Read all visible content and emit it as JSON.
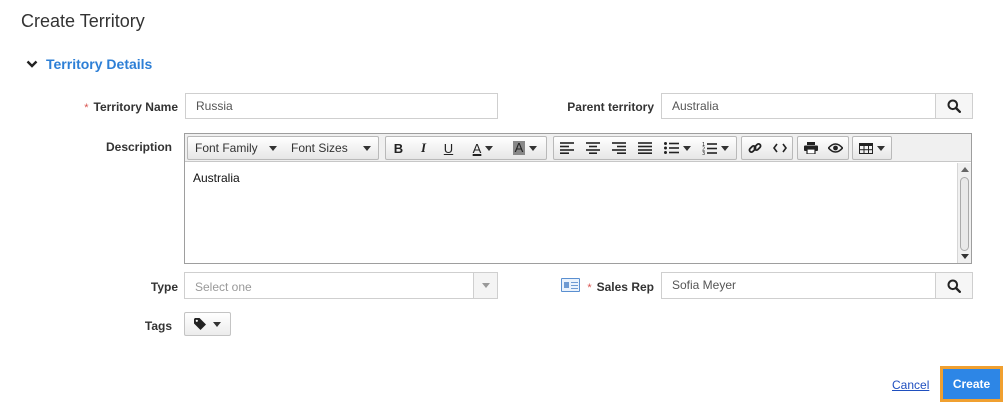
{
  "page": {
    "title": "Create Territory"
  },
  "section": {
    "title": "Territory Details"
  },
  "fields": {
    "territory_name": {
      "label": "Territory Name",
      "required_mark": "*",
      "value": "Russia"
    },
    "parent_territory": {
      "label": "Parent territory",
      "value": "Australia"
    },
    "description": {
      "label": "Description",
      "content": "Australia"
    },
    "type": {
      "label": "Type",
      "placeholder": "Select one"
    },
    "sales_rep": {
      "label": "Sales Rep",
      "required_mark": "*",
      "value": "Sofia Meyer"
    },
    "tags": {
      "label": "Tags"
    }
  },
  "editor_toolbar": {
    "font_family": "Font Family",
    "font_sizes": "Font Sizes",
    "bold": "B",
    "italic": "I",
    "underline": "U",
    "font_color": "A",
    "highlight": "A"
  },
  "actions": {
    "cancel": "Cancel",
    "create": "Create"
  },
  "colors": {
    "accent": "#2d7fd6",
    "create_button": "#2d86e6",
    "focus_outline": "#f0a030",
    "required": "#d9534f"
  }
}
